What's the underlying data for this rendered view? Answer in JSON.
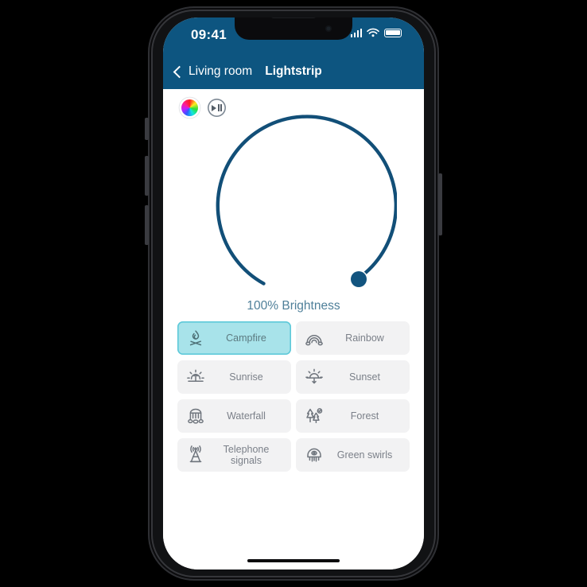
{
  "status_bar": {
    "time": "09:41",
    "signal_icon": "cellular-bars-icon",
    "wifi_icon": "wifi-icon",
    "battery_icon": "battery-full-icon"
  },
  "nav_bar": {
    "back_icon": "chevron-left-icon",
    "back_label": "Living room",
    "title": "Lightstrip"
  },
  "quick_actions": [
    {
      "name": "color-wheel-icon",
      "label": "Color wheel"
    },
    {
      "name": "play-pause-icon",
      "label": "Play / pause"
    }
  ],
  "brightness": {
    "value": 100,
    "label": "100% Brightness",
    "dial_icon": "circular-slider",
    "knob_icon": "dial-knob"
  },
  "presets": [
    {
      "label": "Campfire",
      "icon": "campfire-icon",
      "selected": true
    },
    {
      "label": "Rainbow",
      "icon": "rainbow-icon",
      "selected": false
    },
    {
      "label": "Sunrise",
      "icon": "sunrise-icon",
      "selected": false
    },
    {
      "label": "Sunset",
      "icon": "sunset-icon",
      "selected": false
    },
    {
      "label": "Waterfall",
      "icon": "waterfall-icon",
      "selected": false
    },
    {
      "label": "Forest",
      "icon": "forest-icon",
      "selected": false
    },
    {
      "label": "Telephone signals",
      "icon": "antenna-icon",
      "selected": false
    },
    {
      "label": "Green swirls",
      "icon": "jellyfish-icon",
      "selected": false
    }
  ],
  "colors": {
    "header_blue": "#0d5580",
    "dial_blue": "#124f78",
    "selected_tile_fill": "#a8e3ea",
    "selected_tile_border": "#5ec9d9",
    "tile_fill": "#f2f2f3",
    "brightness_text": "#4e7f99"
  },
  "home_indicator": "home-indicator"
}
